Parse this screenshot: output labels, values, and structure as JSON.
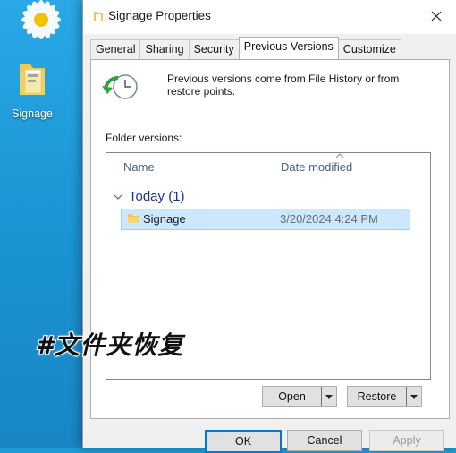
{
  "desktop": {
    "icon_label": "Signage",
    "overlay_text": "#文件夹恢复"
  },
  "dialog": {
    "title": "Signage Properties",
    "tabs": [
      "General",
      "Sharing",
      "Security",
      "Previous Versions",
      "Customize"
    ],
    "active_tab": "Previous Versions",
    "info_text": "Previous versions come from File History or from restore points.",
    "folder_versions_label": "Folder versions:",
    "columns": {
      "name": "Name",
      "date": "Date modified"
    },
    "group": {
      "label": "Today (1)"
    },
    "rows": [
      {
        "name": "Signage",
        "date": "3/20/2024 4:24 PM",
        "selected": true
      }
    ],
    "buttons": {
      "open": "Open",
      "restore": "Restore",
      "ok": "OK",
      "cancel": "Cancel",
      "apply": "Apply"
    }
  },
  "icons": {
    "folder": "folder-icon",
    "close": "close-icon",
    "restore_clock": "restore-clock-icon",
    "chevron_down": "chevron-down-icon",
    "dropdown_arrow": "dropdown-arrow-icon"
  },
  "colors": {
    "desktop_blue": "#1e9ad6",
    "selection": "#cce8ff",
    "group_text": "#1e3287",
    "accent": "#0078d7"
  }
}
